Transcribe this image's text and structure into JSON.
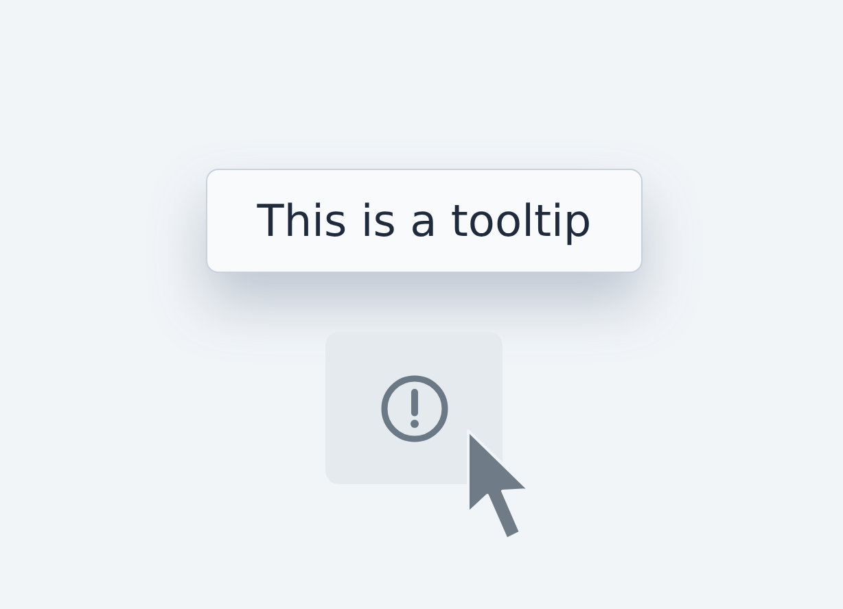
{
  "tooltip": {
    "text": "This is a tooltip"
  }
}
